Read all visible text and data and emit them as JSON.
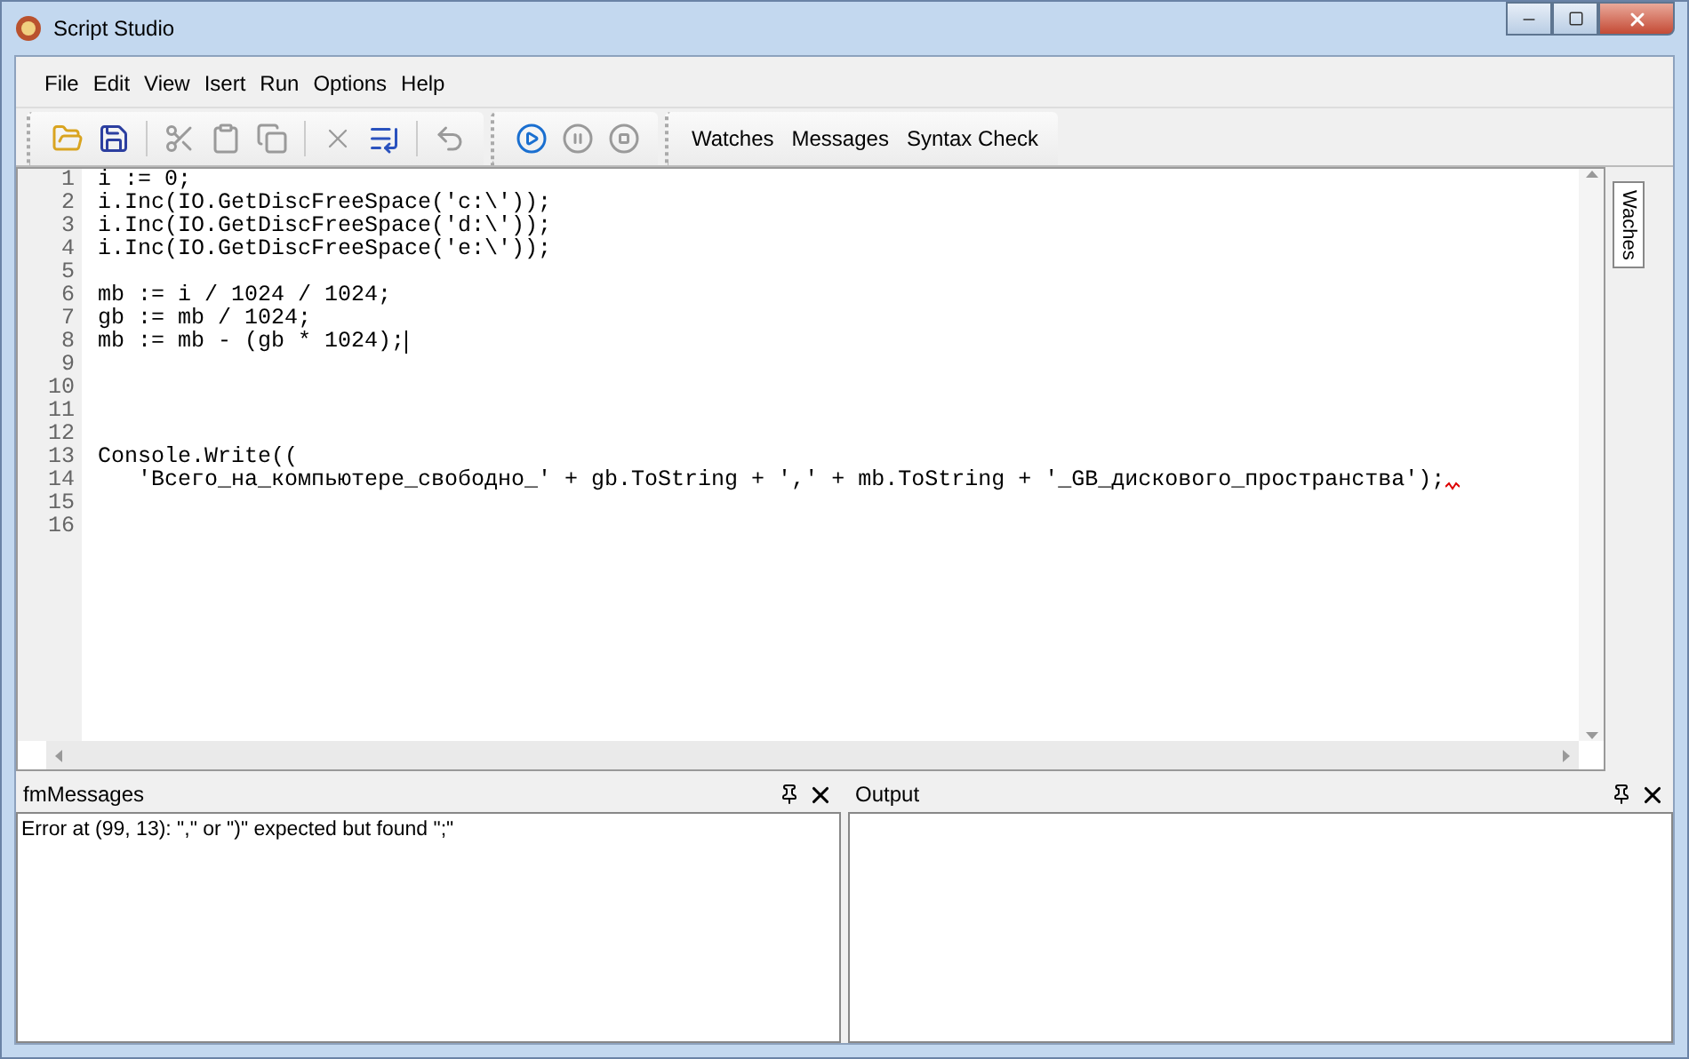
{
  "window": {
    "title": "Script Studio"
  },
  "menu": [
    "File",
    "Edit",
    "View",
    "Isert",
    "Run",
    "Options",
    "Help"
  ],
  "toolbars": [
    {
      "buttons": [
        {
          "kind": "open",
          "disabled": false
        },
        {
          "kind": "save",
          "disabled": false
        },
        {
          "kind": "sep"
        },
        {
          "kind": "cut",
          "disabled": true
        },
        {
          "kind": "paste",
          "disabled": true
        },
        {
          "kind": "copy",
          "disabled": true
        },
        {
          "kind": "sep"
        },
        {
          "kind": "delete",
          "disabled": true
        },
        {
          "kind": "indent",
          "disabled": false
        },
        {
          "kind": "sep"
        },
        {
          "kind": "undo",
          "disabled": true
        }
      ]
    },
    {
      "buttons": [
        {
          "kind": "run",
          "disabled": false
        },
        {
          "kind": "pause",
          "disabled": true
        },
        {
          "kind": "stop",
          "disabled": true
        }
      ]
    },
    {
      "labels": [
        "Watches",
        "Messages",
        "Syntax Check"
      ]
    }
  ],
  "editor": {
    "lines": [
      {
        "number": "1",
        "code": "i := 0;"
      },
      {
        "number": "2",
        "code": "i.Inc(IO.GetDiscFreeSpace('c:\\'));"
      },
      {
        "number": "3",
        "code": "i.Inc(IO.GetDiscFreeSpace('d:\\'));"
      },
      {
        "number": "4",
        "code": "i.Inc(IO.GetDiscFreeSpace('e:\\'));"
      },
      {
        "number": "5"
      },
      {
        "number": "6",
        "code": "mb := i / 1024 / 1024;"
      },
      {
        "number": "7",
        "code": "gb := mb / 1024;"
      },
      {
        "number": "8",
        "code": "mb := mb - (gb * 1024);",
        "cursor": true
      },
      {
        "number": "9"
      },
      {
        "number": "10"
      },
      {
        "number": "11"
      },
      {
        "number": "12"
      },
      {
        "number": "13",
        "code": "Console.Write(("
      },
      {
        "number": "14",
        "code": "   'Всего_на_компьютере_свободно_' + gb.ToString + ',' + mb.ToString + '_GB_дискового_пространства');",
        "error": true
      },
      {
        "number": "15"
      },
      {
        "number": "16"
      }
    ]
  },
  "side_tab": "Waches",
  "panels": [
    {
      "title": "fmMessages",
      "lines": [
        "Error at (99, 13): \",\" or \")\" expected but found \";\""
      ]
    },
    {
      "title": "Output"
    }
  ]
}
